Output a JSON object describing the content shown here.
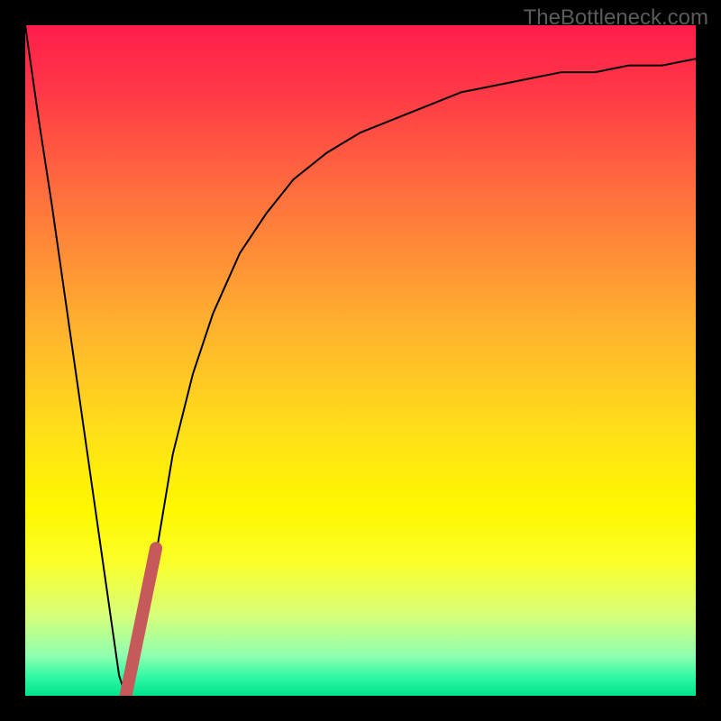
{
  "attribution": "TheBottleneck.com",
  "chart_data": {
    "type": "line",
    "title": "",
    "xlabel": "",
    "ylabel": "",
    "xlim": [
      0,
      100
    ],
    "ylim": [
      0,
      100
    ],
    "background": {
      "gradient_stops": [
        {
          "pos": 0.0,
          "color": "#ff1d4a"
        },
        {
          "pos": 0.1,
          "color": "#ff3946"
        },
        {
          "pos": 0.25,
          "color": "#ff6f3e"
        },
        {
          "pos": 0.45,
          "color": "#ffb22e"
        },
        {
          "pos": 0.6,
          "color": "#ffde1a"
        },
        {
          "pos": 0.72,
          "color": "#fff700"
        },
        {
          "pos": 0.8,
          "color": "#fbff28"
        },
        {
          "pos": 0.88,
          "color": "#d7ff7a"
        },
        {
          "pos": 0.94,
          "color": "#90ffb0"
        },
        {
          "pos": 0.97,
          "color": "#35f9a6"
        },
        {
          "pos": 1.0,
          "color": "#00e58a"
        }
      ]
    },
    "series": [
      {
        "name": "bottleneck-curve",
        "color": "#000000",
        "stroke_width": 2,
        "x": [
          0,
          2,
          4,
          6,
          8,
          10,
          12,
          13,
          14,
          15,
          16,
          18,
          20,
          22,
          25,
          28,
          32,
          36,
          40,
          45,
          50,
          55,
          60,
          65,
          70,
          75,
          80,
          85,
          90,
          95,
          100
        ],
        "y": [
          100,
          86,
          73,
          59,
          45,
          31,
          17,
          10,
          3,
          0,
          2,
          12,
          24,
          36,
          48,
          57,
          66,
          72,
          77,
          81,
          84,
          86,
          88,
          90,
          91,
          92,
          93,
          93,
          94,
          94,
          95
        ]
      },
      {
        "name": "marker-segment",
        "color": "#c65a5a",
        "stroke_width": 14,
        "linecap": "round",
        "x": [
          15,
          19.5
        ],
        "y": [
          0,
          22
        ]
      }
    ]
  }
}
